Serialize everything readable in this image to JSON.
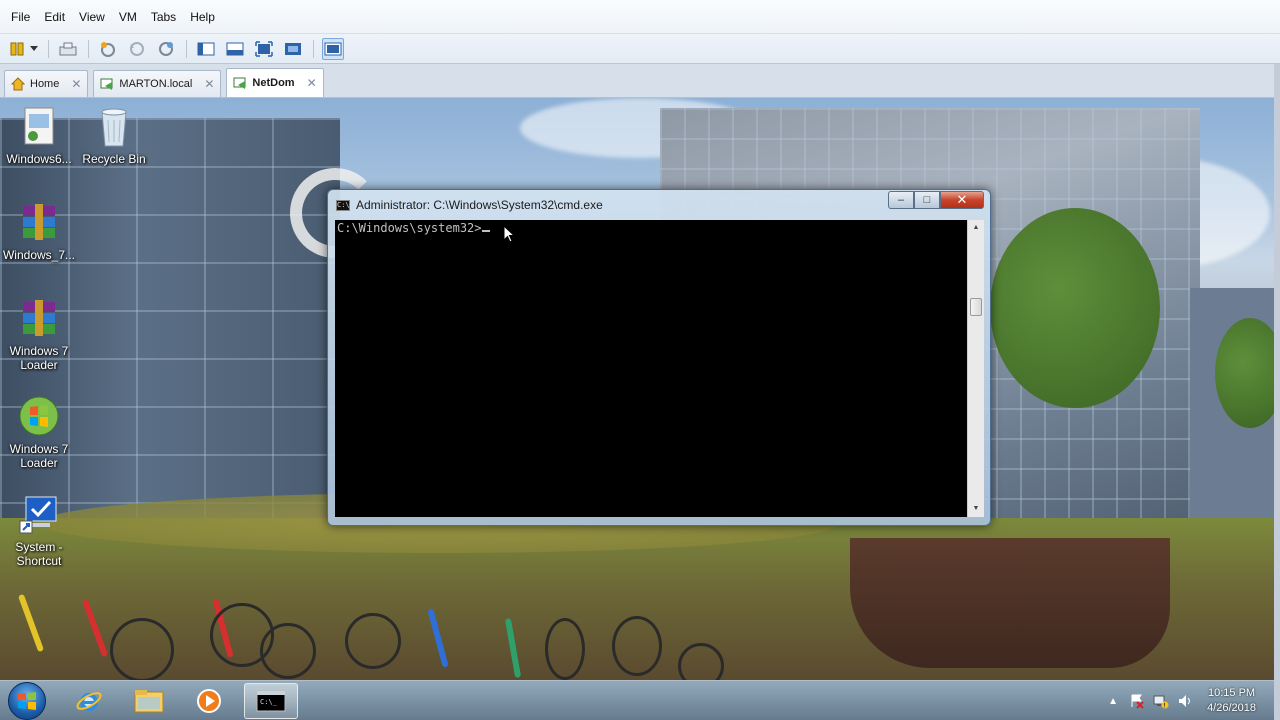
{
  "host": {
    "menu": [
      "File",
      "Edit",
      "View",
      "VM",
      "Tabs",
      "Help"
    ],
    "toolbar_icons": [
      "pause-icon",
      "dropdown-arrow-icon",
      "send-keys-icon",
      "snapshot-icon",
      "revert-snapshot-icon",
      "snapshot-manager-icon",
      "show-library-icon",
      "thumbnail-bar-icon",
      "full-screen-icon",
      "unity-icon",
      "console-view-icon"
    ],
    "tabs": [
      {
        "label": "Home",
        "active": false
      },
      {
        "label": "MARTON.local",
        "active": false
      },
      {
        "label": "NetDom",
        "active": true
      }
    ]
  },
  "desktop": {
    "icons": [
      {
        "label": "Windows6...",
        "icon": "installer-icon"
      },
      {
        "label": "Recycle Bin",
        "icon": "recycle-bin-icon"
      },
      {
        "label": "Windows_7...",
        "icon": "winrar-archive-icon"
      },
      {
        "label": "Windows 7 Loader",
        "icon": "winrar-archive-icon"
      },
      {
        "label": "Windows 7 Loader",
        "icon": "windows-logo-icon"
      },
      {
        "label": "System - Shortcut",
        "icon": "system-shortcut-icon"
      }
    ]
  },
  "cmd": {
    "title": "Administrator: C:\\Windows\\System32\\cmd.exe",
    "prompt": "C:\\Windows\\system32>",
    "minimize": "–",
    "maximize": "□",
    "close": "✕"
  },
  "taskbar": {
    "apps": [
      "internet-explorer-icon",
      "file-explorer-icon",
      "media-player-icon",
      "cmd-icon"
    ],
    "tray_icons": [
      "show-hidden-icons-icon",
      "action-center-icon",
      "network-icon",
      "volume-icon"
    ],
    "time": "10:15 PM",
    "date": "4/26/2018"
  }
}
